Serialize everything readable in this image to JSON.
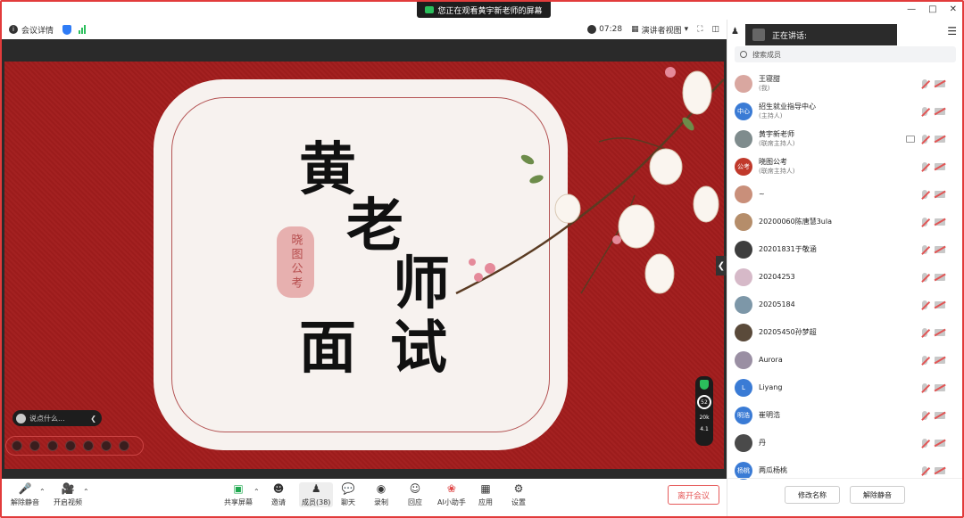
{
  "window": {
    "share_banner": "您正在观看黄宇新老师的屏幕"
  },
  "toolbar": {
    "meeting_info": "会议详情",
    "duration": "07:28",
    "view_mode": "演讲者视图"
  },
  "slide": {
    "title_chars": [
      "黄",
      "老",
      "师",
      "面",
      "试"
    ],
    "seal_text": "晓图公考"
  },
  "chat": {
    "placeholder": "说点什么..."
  },
  "network": {
    "quality": "52",
    "up": "20k",
    "down": "4.1"
  },
  "bottom": {
    "unmute": "解除静音",
    "video": "开启视频",
    "share": "共享屏幕",
    "invite": "邀请",
    "members": "成员(38)",
    "chat": "聊天",
    "record": "录制",
    "reactions": "回应",
    "ai": "AI小助手",
    "apps": "应用",
    "settings": "设置",
    "leave": "离开会议"
  },
  "panel": {
    "speaking": "正在讲话:",
    "search_placeholder": "搜索成员",
    "rename": "修改名称",
    "unmute": "解除静音",
    "members": [
      {
        "name": "王寝甜",
        "role": "(我)",
        "avatar": "",
        "color": "#d9a7a0"
      },
      {
        "name": "招生就业指导中心",
        "role": "(主持人)",
        "avatar": "中心",
        "color": "#3a7bd5"
      },
      {
        "name": "黄宇新老师",
        "role": "(联席主持人)",
        "avatar": "",
        "color": "#7f8c8d",
        "screen": true
      },
      {
        "name": "晓图公考",
        "role": "(联席主持人)",
        "avatar": "公考",
        "color": "#c0392b"
      },
      {
        "name": "~",
        "role": "",
        "avatar": "",
        "color": "#c98f7a"
      },
      {
        "name": "20200060陈唐慧3ula",
        "role": "",
        "avatar": "",
        "color": "#b58d6a"
      },
      {
        "name": "20201831于敬涵",
        "role": "",
        "avatar": "",
        "color": "#3d3d3d"
      },
      {
        "name": "20204253",
        "role": "",
        "avatar": "",
        "color": "#d6b9c8"
      },
      {
        "name": "20205184",
        "role": "",
        "avatar": "",
        "color": "#7d97a8"
      },
      {
        "name": "20205450孙梦超",
        "role": "",
        "avatar": "",
        "color": "#5a4a3a"
      },
      {
        "name": "Aurora",
        "role": "",
        "avatar": "",
        "color": "#9a8fa3"
      },
      {
        "name": "Liyang",
        "role": "",
        "avatar": "L",
        "color": "#3a7bd5"
      },
      {
        "name": "崔明浩",
        "role": "",
        "avatar": "明浩",
        "color": "#3a7bd5"
      },
      {
        "name": "丹",
        "role": "",
        "avatar": "",
        "color": "#4a4a4a"
      },
      {
        "name": "两瓜杨桃",
        "role": "",
        "avatar": "杨桃",
        "color": "#3a7bd5"
      }
    ]
  },
  "colors": {
    "accent_blue": "#2f7cf6",
    "slide_red": "#a21d1d",
    "leave_red": "#e65a5a",
    "mute_red": "#e25555"
  }
}
